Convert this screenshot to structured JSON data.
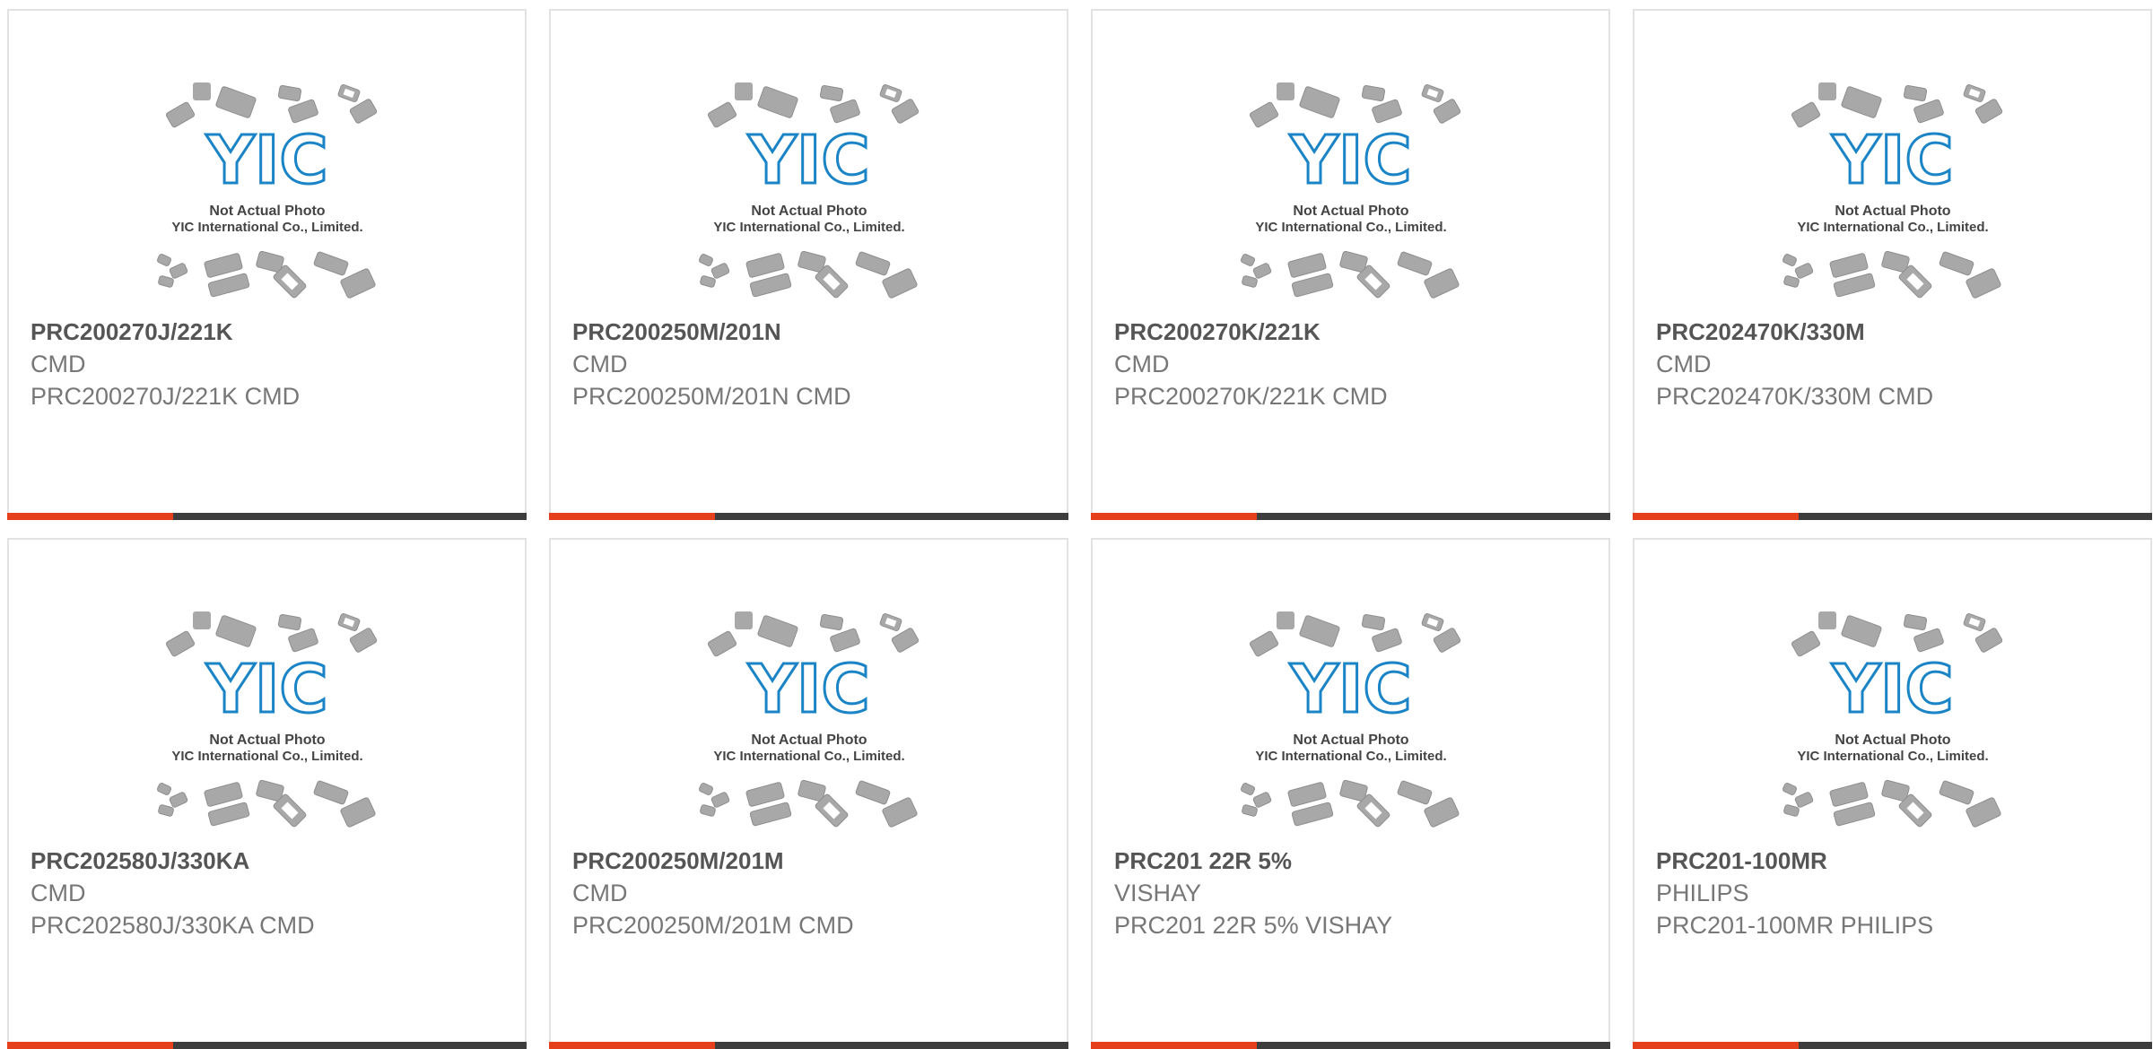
{
  "colors": {
    "accent": "#e5401c",
    "bar_dark": "#3d3d3d",
    "logo_blue": "#1a84c6",
    "chip_gray": "#a8a8a8"
  },
  "placeholder": {
    "line1": "Not Actual Photo",
    "line2": "YIC International Co., Limited.",
    "logo_text": "YIC"
  },
  "products": [
    {
      "part": "PRC200270J/221K",
      "maker": "CMD",
      "desc": "PRC200270J/221K CMD"
    },
    {
      "part": "PRC200250M/201N",
      "maker": "CMD",
      "desc": "PRC200250M/201N CMD"
    },
    {
      "part": "PRC200270K/221K",
      "maker": "CMD",
      "desc": "PRC200270K/221K CMD"
    },
    {
      "part": "PRC202470K/330M",
      "maker": "CMD",
      "desc": "PRC202470K/330M CMD"
    },
    {
      "part": "PRC202580J/330KA",
      "maker": "CMD",
      "desc": "PRC202580J/330KA CMD"
    },
    {
      "part": "PRC200250M/201M",
      "maker": "CMD",
      "desc": "PRC200250M/201M CMD"
    },
    {
      "part": "PRC201 22R 5%",
      "maker": "VISHAY",
      "desc": "PRC201 22R 5% VISHAY"
    },
    {
      "part": "PRC201-100MR",
      "maker": "PHILIPS",
      "desc": "PRC201-100MR PHILIPS"
    }
  ]
}
